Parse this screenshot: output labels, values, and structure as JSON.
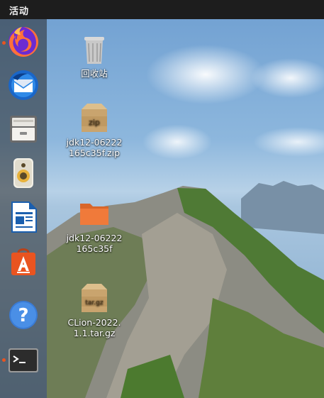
{
  "topbar": {
    "activities_label": "活动"
  },
  "dock": {
    "items": [
      {
        "name": "firefox",
        "icon": "firefox-icon",
        "running": true
      },
      {
        "name": "thunderbird",
        "icon": "thunderbird-icon",
        "running": false
      },
      {
        "name": "files",
        "icon": "file-cabinet-icon",
        "running": false
      },
      {
        "name": "rhythmbox",
        "icon": "speaker-icon",
        "running": false
      },
      {
        "name": "libreoffice-writer",
        "icon": "writer-document-icon",
        "running": false
      },
      {
        "name": "ubuntu-software",
        "icon": "software-bag-icon",
        "running": false
      },
      {
        "name": "help",
        "icon": "help-icon",
        "running": false
      },
      {
        "name": "terminal",
        "icon": "terminal-icon",
        "running": true
      }
    ]
  },
  "desktop": {
    "icons": [
      {
        "label": "回收站",
        "icon": "trash-icon"
      },
      {
        "label": "jdk12-06222165c35f.zip",
        "icon": "zip-archive-icon",
        "badge": "zip"
      },
      {
        "label": "jdk12-06222165c35f",
        "icon": "folder-icon"
      },
      {
        "label": "CLion-2022.1.1.tar.gz",
        "icon": "tar-archive-icon",
        "badge": "tar.gz"
      }
    ]
  },
  "colors": {
    "topbar": "#1d1d1d",
    "accent": "#e95420",
    "folder": "#f07a3a",
    "archive": "#c9a46e"
  }
}
